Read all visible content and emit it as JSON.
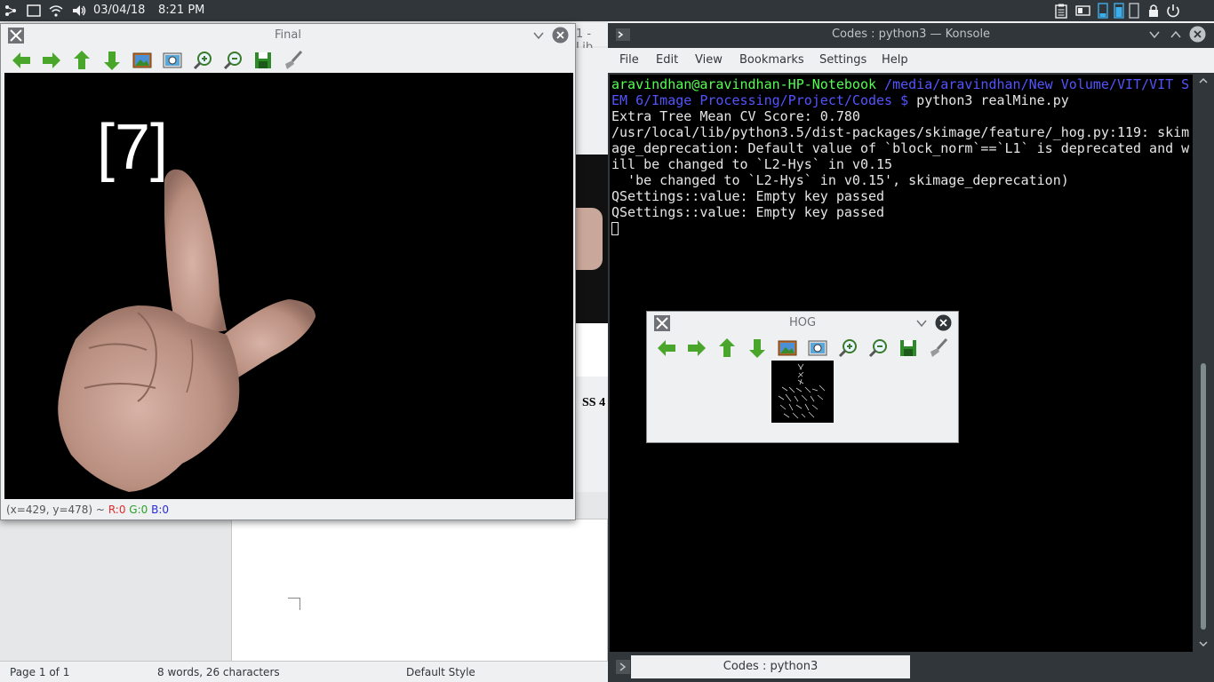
{
  "panel": {
    "date": "03/04/18",
    "time": "8:21 PM",
    "icons": [
      "app-launcher-icon",
      "show-desktop-icon",
      "wifi-icon",
      "volume-icon",
      "clipboard-icon",
      "battery-icon",
      "lock-screen-icon",
      "power-icon"
    ]
  },
  "writer": {
    "title_fragment": "1 - Lib",
    "page_text": "SS 4",
    "status": {
      "page": "Page 1 of 1",
      "words": "8 words, 26 characters",
      "style": "Default Style"
    }
  },
  "final_window": {
    "title": "Final",
    "toolbar": [
      "arrow-left-icon",
      "arrow-right-icon",
      "arrow-up-icon",
      "arrow-down-icon",
      "image-icon",
      "screenshot-icon",
      "zoom-in-icon",
      "zoom-out-icon",
      "save-icon",
      "brush-icon"
    ],
    "prediction": "[7]",
    "status": {
      "coords": "(x=429, y=478) ~",
      "r": "R:0",
      "g": "G:0",
      "b": "B:0"
    }
  },
  "konsole": {
    "title": "Codes : python3 — Konsole",
    "menu": [
      "File",
      "Edit",
      "View",
      "Bookmarks",
      "Settings",
      "Help"
    ],
    "prompt_user": "aravindhan@aravindhan-HP-Notebook",
    "prompt_path_1": " /media/aravindhan/New Volume/VIT/VIT S",
    "prompt_path_2": "EM 6/Image Processing/Project/Codes $",
    "command": " python3 realMine.py",
    "output": [
      "Extra Tree Mean CV Score: 0.780",
      "/usr/local/lib/python3.5/dist-packages/skimage/feature/_hog.py:119: skim",
      "age_deprecation: Default value of `block_norm`==`L1` is deprecated and w",
      "ill be changed to `L2-Hys` in v0.15",
      "  'be changed to `L2-Hys` in v0.15', skimage_deprecation)",
      "QSettings::value: Empty key passed",
      "QSettings::value: Empty key passed"
    ],
    "tab_label": "Codes : python3"
  },
  "hog_window": {
    "title": "HOG"
  },
  "colors": {
    "prompt_green": "#54ff54",
    "prompt_blue": "#5454ff",
    "panel_bg": "#31363b"
  }
}
